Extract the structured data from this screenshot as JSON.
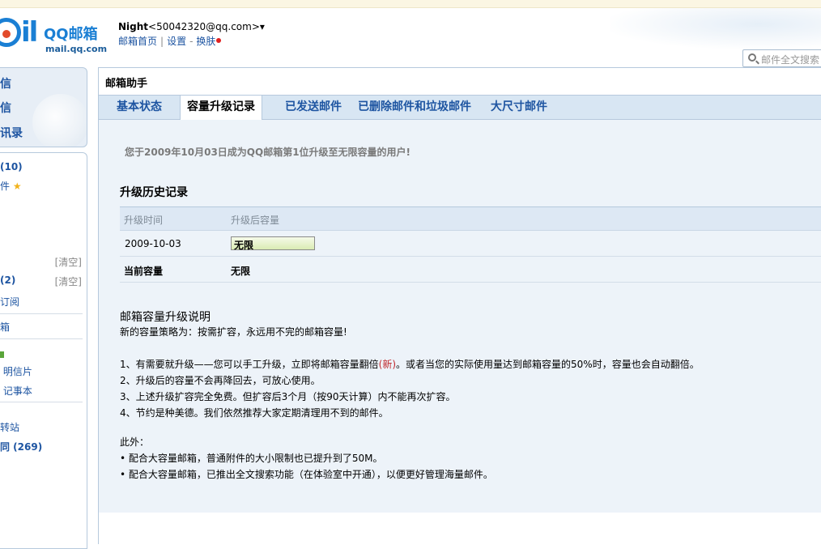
{
  "header": {
    "logo_text": "QQ邮箱",
    "logo_domain": "mail.qq.com",
    "user_nick": "Night",
    "user_addr": "<50042320@qq.com>",
    "dropdown": "▾",
    "links": [
      "邮箱首页",
      "设置",
      "换肤"
    ],
    "search_placeholder": "邮件全文搜索"
  },
  "sidebar": {
    "top_items": [
      "信",
      "信",
      "讯录"
    ],
    "rows": [
      {
        "label": "(10)",
        "bold": true
      },
      {
        "label": "件",
        "star": "★"
      },
      {
        "label": "[清空]",
        "type": "clear"
      },
      {
        "label": "(2)",
        "bold": true,
        "clear": "[清空]"
      },
      {
        "label": "订阅"
      },
      {
        "label": "箱"
      },
      {
        "label": "明信片"
      },
      {
        "label": "记事本"
      },
      {
        "label": "转站"
      },
      {
        "label": "同 (269)",
        "bold": true
      }
    ]
  },
  "main": {
    "title": "邮箱助手",
    "tabs": [
      "基本状态",
      "容量升级记录",
      "已发送邮件",
      "已删除邮件和垃圾邮件",
      "大尺寸邮件"
    ],
    "active_tab": 1,
    "announcement": "您于2009年10月03日成为QQ邮箱第1位升级至无限容量的用户!",
    "history_title": "升级历史记录",
    "table": {
      "headers": [
        "升级时间",
        "升级后容量"
      ],
      "rows": [
        {
          "time": "2009-10-03",
          "capacity": "无限"
        }
      ],
      "current_label": "当前容量",
      "current_value": "无限"
    },
    "explain": {
      "heading": "邮箱容量升级说明",
      "policy": "新的容量策略为：按需扩容，永远用不完的邮箱容量!",
      "item1_a": "1、有需要就升级——您可以手工升级，立即将邮箱容量翻倍",
      "item1_new": "(新)",
      "item1_b": "。或者当您的实际使用量达到邮箱容量的50%时，容量也会自动翻倍。",
      "item2": "2、升级后的容量不会再降回去，可放心使用。",
      "item3": "3、上述升级扩容完全免费。但扩容后3个月（按90天计算）内不能再次扩容。",
      "item4": "4、节约是种美德。我们依然推荐大家定期清理用不到的邮件。",
      "also": "此外：",
      "bullet1": "• 配合大容量邮箱，普通附件的大小限制也已提升到了50M。",
      "bullet2": "• 配合大容量邮箱，已推出全文搜索功能（在体验室中开通），以便更好管理海量邮件。"
    }
  },
  "colors": {
    "link": "#1d54a1",
    "tabbar": "#d8e6f3",
    "content_bg": "#edf3f9",
    "new_red": "#c0282c"
  }
}
